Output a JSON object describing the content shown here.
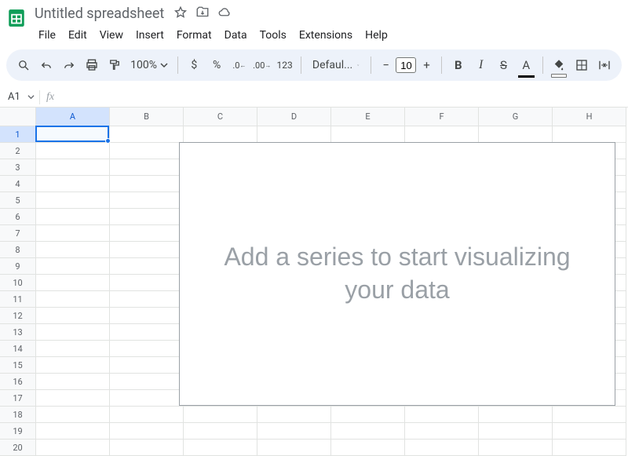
{
  "header": {
    "doc_title": "Untitled spreadsheet",
    "menus": [
      "File",
      "Edit",
      "View",
      "Insert",
      "Format",
      "Data",
      "Tools",
      "Extensions",
      "Help"
    ]
  },
  "toolbar": {
    "zoom": "100%",
    "font": "Defaul...",
    "font_size": "10",
    "currency_label": "$",
    "percent_label": "%",
    "dec_dec": ".0",
    "dec_inc": ".00",
    "num_fmt": "123"
  },
  "formula_bar": {
    "namebox": "A1",
    "fx": "fx"
  },
  "grid": {
    "columns": [
      "A",
      "B",
      "C",
      "D",
      "E",
      "F",
      "G",
      "H"
    ],
    "rows": [
      "1",
      "2",
      "3",
      "4",
      "5",
      "6",
      "7",
      "8",
      "9",
      "10",
      "11",
      "12",
      "13",
      "14",
      "15",
      "16",
      "17",
      "18",
      "19",
      "20"
    ],
    "selected_cell": "A1"
  },
  "chart_overlay": {
    "message": "Add a series to start visualizing your data"
  }
}
